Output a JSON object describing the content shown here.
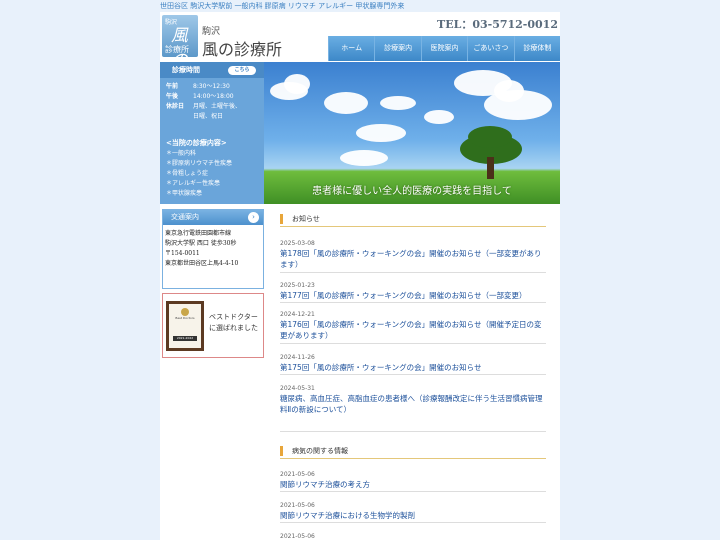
{
  "topline": "世田谷区 駒沢大学駅前 一般内科 膠原病 リウマチ アレルギー 甲状腺専門外来",
  "header": {
    "logo_lines": [
      "駒沢",
      "風の",
      "診療所"
    ],
    "site_sub": "駒沢",
    "site_name": "風の診療所",
    "tel": "TEL：03-5712-0012"
  },
  "nav": [
    "ホーム",
    "診療案内",
    "医院案内",
    "ごあいさつ",
    "診療体制"
  ],
  "hours": {
    "title": "診療時間",
    "link": "こちら",
    "rows": [
      {
        "k": "午前",
        "v": "8:30〜12:30"
      },
      {
        "k": "午後",
        "v": "14:00〜18:00"
      },
      {
        "k": "休診日",
        "v": "月曜、土曜午後、"
      },
      {
        "k": "",
        "v": "日曜、祝日"
      }
    ],
    "services_title": "<当院の診療内容>",
    "services": [
      "＊一般内科",
      "＊膠原病リウマチ性疾患",
      "＊骨粗しょう症",
      "＊アレルギー性疾患",
      "＊甲状腺疾患"
    ]
  },
  "access": {
    "title": "交通案内",
    "lines": [
      "東京急行電鉄田園都市線",
      "駒沢大学駅 西口 徒歩30秒",
      "〒154-0011",
      "東京都世田谷区上馬4-4-10"
    ]
  },
  "bestdoctor": {
    "award_label": "Best Doctors",
    "award_year": "2021-2022",
    "text_lines": [
      "ベストドクター",
      "に選ばれました"
    ]
  },
  "hero": {
    "tagline": "患者様に優しい全人的医療の実践を目指して"
  },
  "news": {
    "title": "お知らせ",
    "items": [
      {
        "date": "2025-03-08",
        "title": "第178回「風の診療所・ウォーキングの会」開催のお知らせ（一部変更があります）"
      },
      {
        "date": "2025-01-23",
        "title": "第177回「風の診療所・ウォーキングの会」開催のお知らせ（一部変更）"
      },
      {
        "date": "2024-12-21",
        "title": "第176回「風の診療所・ウォーキングの会」開催のお知らせ（開催予定日の変更があります）"
      },
      {
        "date": "2024-11-26",
        "title": "第175回「風の診療所・ウォーキングの会」開催のお知らせ"
      },
      {
        "date": "2024-05-31",
        "title": "糖尿病、高血圧症、高脂血症の患者様へ（診療報酬改定に伴う生活習慣病管理料Ⅱの新設について）"
      }
    ]
  },
  "disease": {
    "title": "病気の関する情報",
    "items": [
      {
        "date": "2021-05-06",
        "title": "関節リウマチ治療の考え方"
      },
      {
        "date": "2021-05-06",
        "title": "関節リウマチ治療における生物学的製剤"
      },
      {
        "date": "2021-05-06",
        "title": ""
      }
    ]
  }
}
